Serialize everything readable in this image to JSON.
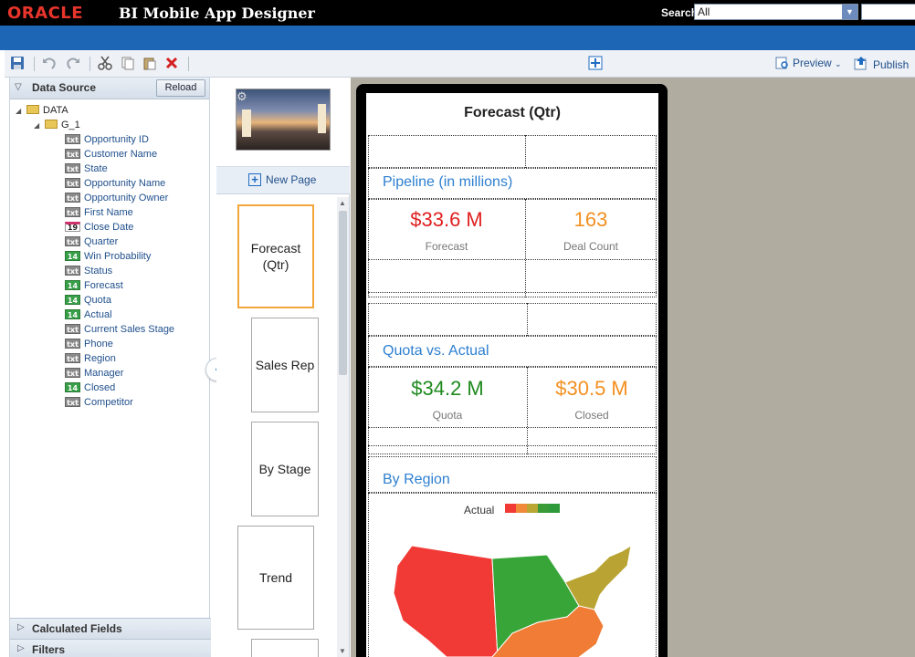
{
  "header": {
    "logo": "ORACLE",
    "app_title": "BI Mobile App Designer",
    "search_label": "Search",
    "search_scope": "All",
    "search_placeholder": ""
  },
  "toolbar": {
    "preview_label": "Preview",
    "publish_label": "Publish",
    "icons": [
      "save-icon",
      "undo-icon",
      "redo-icon",
      "cut-icon",
      "copy-icon",
      "paste-icon",
      "delete-icon",
      "add-icon"
    ]
  },
  "data_source": {
    "title": "Data Source",
    "reload_label": "Reload",
    "root": "DATA",
    "group": "G_1",
    "fields": [
      {
        "type": "txt",
        "name": "Opportunity ID"
      },
      {
        "type": "txt",
        "name": "Customer Name"
      },
      {
        "type": "txt",
        "name": "State"
      },
      {
        "type": "txt",
        "name": "Opportunity Name"
      },
      {
        "type": "txt",
        "name": "Opportunity Owner"
      },
      {
        "type": "txt",
        "name": "First Name"
      },
      {
        "type": "19",
        "name": "Close Date"
      },
      {
        "type": "txt",
        "name": "Quarter"
      },
      {
        "type": "14",
        "name": "Win Probability"
      },
      {
        "type": "txt",
        "name": "Status"
      },
      {
        "type": "14",
        "name": "Forecast"
      },
      {
        "type": "14",
        "name": "Quota"
      },
      {
        "type": "14",
        "name": "Actual"
      },
      {
        "type": "txt",
        "name": "Current Sales Stage"
      },
      {
        "type": "txt",
        "name": "Phone"
      },
      {
        "type": "txt",
        "name": "Region"
      },
      {
        "type": "txt",
        "name": "Manager"
      },
      {
        "type": "14",
        "name": "Closed"
      },
      {
        "type": "txt",
        "name": "Competitor"
      }
    ]
  },
  "accordion": {
    "calculated_fields": "Calculated Fields",
    "filters": "Filters"
  },
  "pages": {
    "new_page_label": "New Page",
    "items": [
      "Forecast (Qtr)",
      "Sales Rep",
      "By Stage",
      "Trend"
    ],
    "active_index": 0
  },
  "screen": {
    "title": "Forecast (Qtr)",
    "pipeline_title": "Pipeline (in millions)",
    "forecast_value": "$33.6 M",
    "forecast_label": "Forecast",
    "deal_count_value": "163",
    "deal_count_label": "Deal Count",
    "quota_title": "Quota vs. Actual",
    "quota_value": "$34.2 M",
    "quota_label": "Quota",
    "closed_value": "$30.5 M",
    "closed_label": "Closed",
    "region_title": "By Region",
    "legend_label": "Actual",
    "legend_colors": [
      "#f13a36",
      "#f08a3a",
      "#b9a633",
      "#3a9a38",
      "#2e9a3a"
    ],
    "region_colors": {
      "west": "#f13a36",
      "central": "#37a537",
      "northeast": "#b9a433",
      "southeast": "#f07c35"
    }
  },
  "colors": {
    "red": "#e02020",
    "orange": "#f39021",
    "green": "#1e8a1e",
    "accent": "#2d7fd0"
  }
}
